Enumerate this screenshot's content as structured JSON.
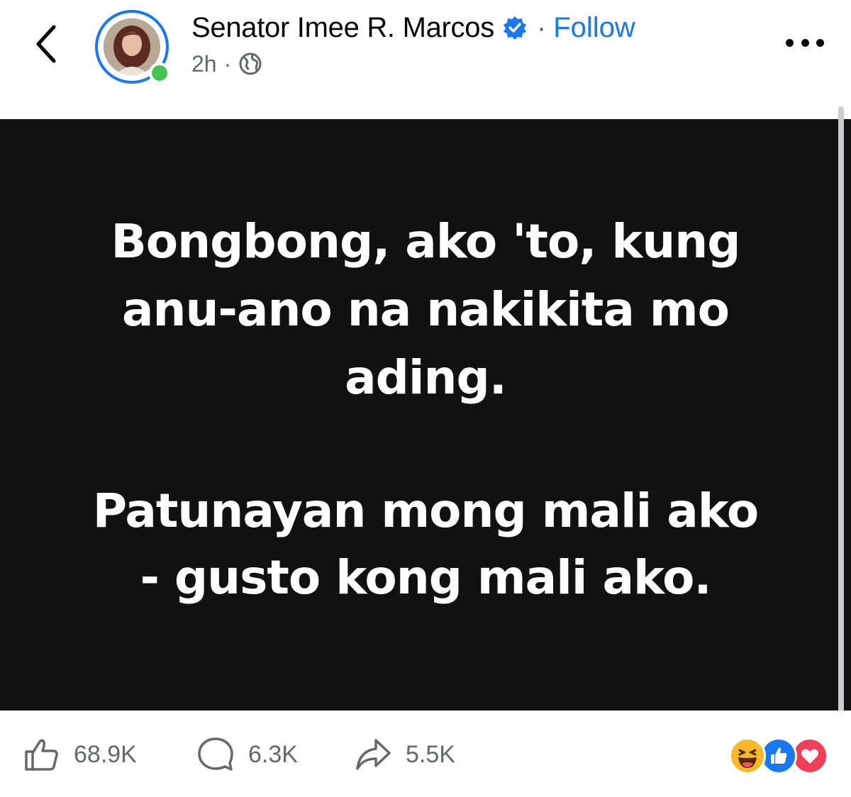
{
  "header": {
    "author_name": "Senator Imee R. Marcos",
    "separator": "·",
    "follow_label": "Follow",
    "time": "2h",
    "meta_separator": "·",
    "icons": [
      "back-chevron-icon",
      "avatar",
      "online-status-icon",
      "verified-badge-icon",
      "globe-icon",
      "more-options-icon"
    ],
    "colors": {
      "accent": "#1877f2",
      "online": "#44c553",
      "muted": "#65676b"
    }
  },
  "post": {
    "background_color": "#111111",
    "text_color": "#ffffff",
    "lines": [
      "Bongbong, ako 'to, kung",
      "anu-ano na nakikita mo",
      "ading.",
      "Patunayan mong mali ako",
      "- gusto kong mali ako."
    ]
  },
  "footer": {
    "like_count": "68.9K",
    "comment_count": "6.3K",
    "share_count": "5.5K",
    "reactions": [
      "haha-reaction-icon",
      "like-reaction-icon",
      "love-reaction-icon"
    ]
  }
}
